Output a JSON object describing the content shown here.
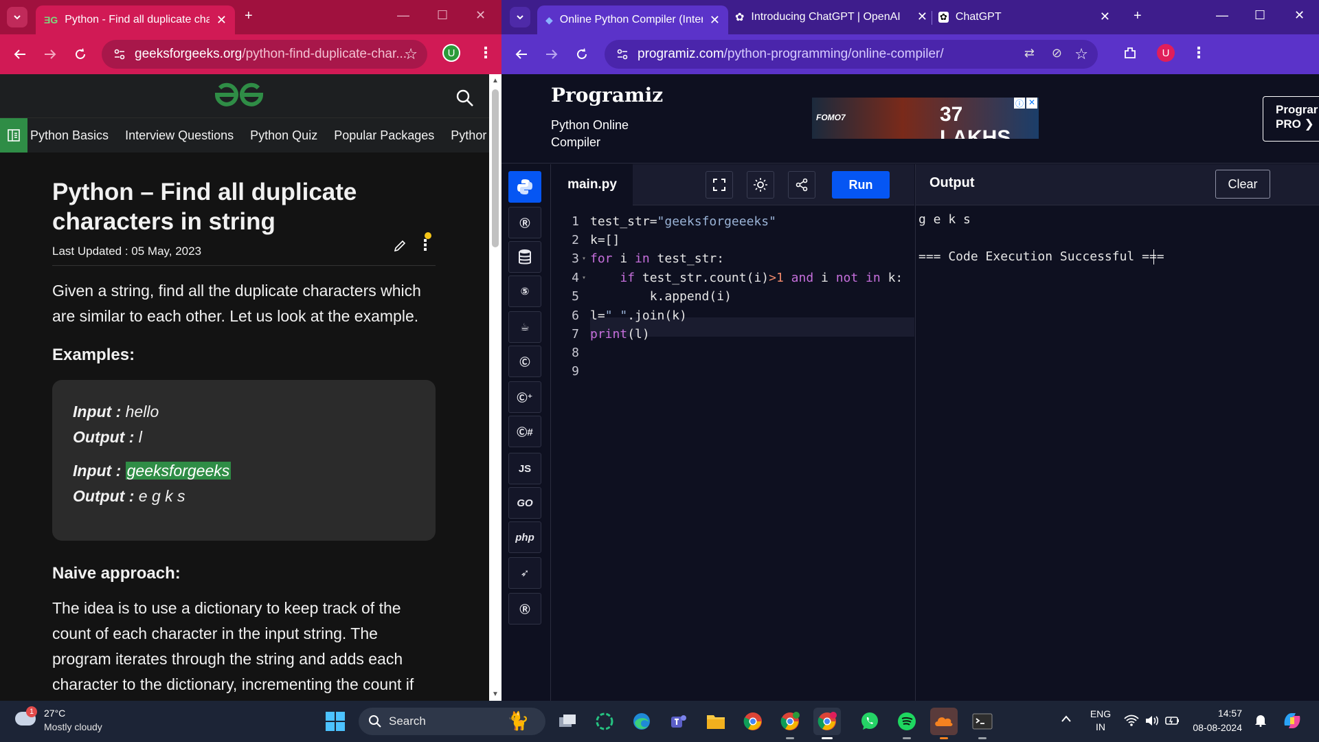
{
  "left_window": {
    "tab_title": "Python - Find all duplicate char",
    "url_domain": "geeksforgeeks.org",
    "url_path": "/python-find-duplicate-char...",
    "profile_initial": "U",
    "nav_items": [
      "Python Basics",
      "Interview Questions",
      "Python Quiz",
      "Popular Packages",
      "Pythor"
    ],
    "article": {
      "title": "Python – Find all duplicate characters in string",
      "updated": "Last Updated : 05 May, 2023",
      "intro": "Given a string, find all the duplicate characters which are similar to each other. Let us look at the example.",
      "examples_heading": "Examples:",
      "example1_input_label": "Input :",
      "example1_input": " hello",
      "example1_output_label": "Output :",
      "example1_output": " l",
      "example2_input_label": "Input :",
      "example2_input": "geeksforgeeks",
      "example2_output_label": "Output :",
      "example2_output": " e g k s",
      "naive_heading": "Naive approach:",
      "naive_para": "The idea is to use a dictionary to keep track of the count of each character in the input string. The program iterates through the string and adds each character to the dictionary, incrementing the count if"
    }
  },
  "right_window": {
    "tabs": [
      {
        "title": "Online Python Compiler (Inter"
      },
      {
        "title": "Introducing ChatGPT | OpenAI"
      },
      {
        "title": "ChatGPT"
      }
    ],
    "url_domain": "programiz.com",
    "url_path": "/python-programming/online-compiler/",
    "profile_initial": "U",
    "brand": "Programiz",
    "brand_sub": "Python Online Compiler",
    "ad_text": "37 LAKHS",
    "ad_brand": "FOMO7",
    "pro_button": "Prograr PRO ❯",
    "file_tab": "main.py",
    "run_label": "Run",
    "output_label": "Output",
    "clear_label": "Clear",
    "line_numbers": [
      "1",
      "2",
      "3",
      "4",
      "5",
      "6",
      "7",
      "8",
      "9"
    ],
    "output_lines": [
      "g e k s",
      "",
      "=== Code Execution Successful ==="
    ],
    "languages": [
      "python",
      "r",
      "sql",
      "html5",
      "java",
      "c",
      "c++",
      "c#",
      "JS",
      "GO",
      "php",
      "swift",
      "rust"
    ]
  },
  "taskbar": {
    "weather_temp": "27°C",
    "weather_desc": "Mostly cloudy",
    "weather_badge": "1",
    "search_label": "Search",
    "lang_top": "ENG",
    "lang_bottom": "IN",
    "time": "14:57",
    "date": "08-08-2024"
  },
  "colors": {
    "gfg_green": "#2f8d46",
    "programiz_blue": "#0556f3",
    "left_chrome": "#d11a55",
    "right_chrome": "#5b33c9"
  }
}
